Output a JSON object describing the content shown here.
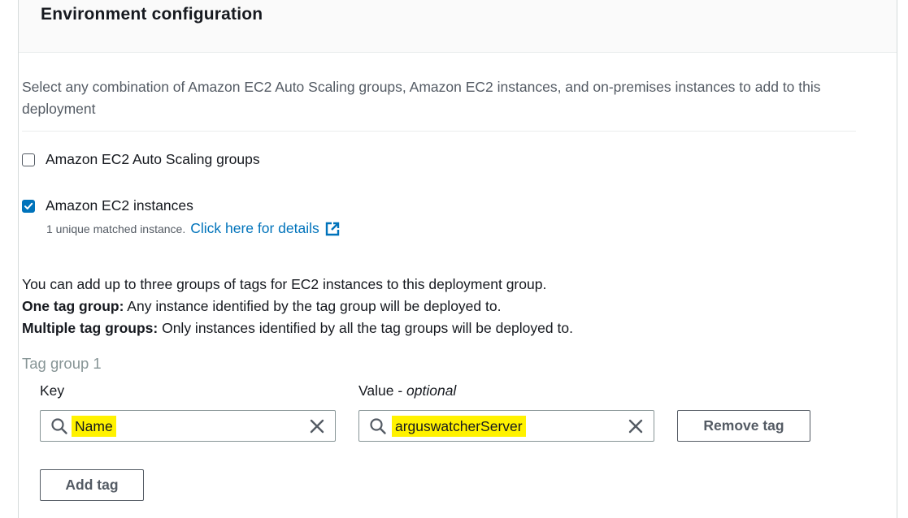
{
  "section": {
    "title": "Environment configuration",
    "description": "Select any combination of Amazon EC2 Auto Scaling groups, Amazon EC2 instances, and on-premises instances to add to this deployment"
  },
  "options": {
    "auto_scaling": {
      "label": "Amazon EC2 Auto Scaling groups",
      "checked": false
    },
    "ec2_instances": {
      "label": "Amazon EC2 instances",
      "checked": true,
      "matched_note": "1 unique matched instance.",
      "details_link": "Click here for details"
    }
  },
  "tag_info": {
    "line1": "You can add up to three groups of tags for EC2 instances to this deployment group.",
    "one_group_label": "One tag group:",
    "one_group_text": " Any instance identified by the tag group will be deployed to.",
    "multi_group_label": "Multiple tag groups:",
    "multi_group_text": " Only instances identified by all the tag groups will be deployed to."
  },
  "tag_group": {
    "title": "Tag group 1",
    "key_label": "Key",
    "value_label": "Value - ",
    "value_optional": "optional",
    "key_value": "Name",
    "value_value": "arguswatcherServer",
    "remove_button": "Remove tag",
    "add_button": "Add tag"
  },
  "colors": {
    "link": "#0073bb",
    "checkbox_checked": "#0073bb",
    "highlight": "#fff200"
  }
}
